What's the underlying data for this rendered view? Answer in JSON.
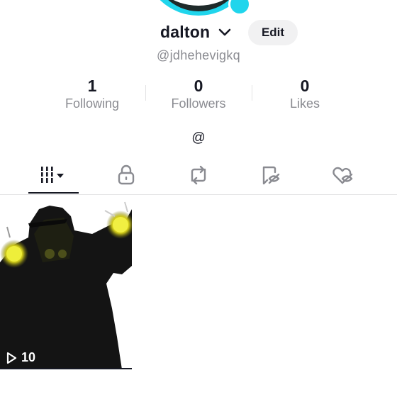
{
  "profile": {
    "username": "dalton",
    "edit_label": "Edit",
    "handle": "@jdhehevigkq",
    "bio": "@"
  },
  "stats": [
    {
      "value": "1",
      "label": "Following"
    },
    {
      "value": "0",
      "label": "Followers"
    },
    {
      "value": "0",
      "label": "Likes"
    }
  ],
  "tabs": [
    {
      "icon": "grid-icon",
      "selected": true
    },
    {
      "icon": "lock-icon",
      "selected": false
    },
    {
      "icon": "repost-icon",
      "selected": false
    },
    {
      "icon": "bookmark-eye-icon",
      "selected": false
    },
    {
      "icon": "heart-eye-icon",
      "selected": false
    }
  ],
  "videos": [
    {
      "views": "10",
      "icon": "play-icon"
    }
  ],
  "colors": {
    "accent": "#20d5ec",
    "text": "#161823",
    "muted": "#8a8b91",
    "button_bg": "#f1f1f2"
  }
}
